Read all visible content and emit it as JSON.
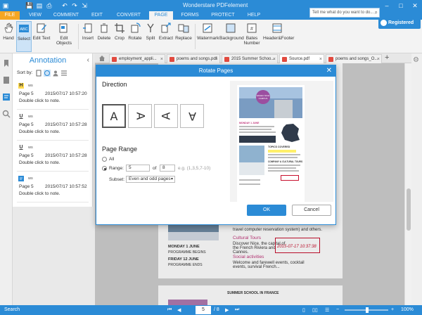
{
  "app": {
    "title": "Wonderstare PDFelement",
    "window_controls": [
      "minimize-icon",
      "maximize-icon",
      "close-icon"
    ],
    "quick_access": [
      "save-icon",
      "open-icon",
      "print-icon",
      "undo-icon",
      "redo-icon",
      "fit-icon"
    ]
  },
  "menu": {
    "tabs": [
      "FILE",
      "VIEW",
      "COMMENT",
      "EDIT",
      "CONVERT",
      "PAGE",
      "FORMS",
      "PROTECT",
      "HELP"
    ],
    "active": "PAGE"
  },
  "tell_me": {
    "placeholder": "Tell me what do you want to do..."
  },
  "account": {
    "label": "Registered"
  },
  "ribbon": {
    "tools": [
      {
        "label": "Hand",
        "icon": "hand-icon"
      },
      {
        "label": "Select",
        "icon": "select-icon"
      },
      {
        "label": "Edit Text",
        "icon": "edit-text-icon"
      },
      {
        "label": "Edit Objects",
        "icon": "edit-objects-icon"
      }
    ],
    "page_tools": [
      {
        "label": "Insert",
        "icon": "insert-icon"
      },
      {
        "label": "Delete",
        "icon": "delete-icon"
      },
      {
        "label": "Crop",
        "icon": "crop-icon"
      },
      {
        "label": "Rotate",
        "icon": "rotate-icon"
      },
      {
        "label": "Split",
        "icon": "split-icon"
      },
      {
        "label": "Extract",
        "icon": "extract-icon"
      },
      {
        "label": "Replace",
        "icon": "replace-icon"
      }
    ],
    "design_tools": [
      {
        "label": "Watermark",
        "icon": "watermark-icon"
      },
      {
        "label": "Background",
        "icon": "background-icon"
      },
      {
        "label": "Bates Number",
        "icon": "bates-number-icon"
      },
      {
        "label": "Header&Footer",
        "icon": "header-footer-icon"
      }
    ]
  },
  "annotation_panel": {
    "title": "Annotation",
    "sort_by": "Sort by:",
    "notes": [
      {
        "type": "H",
        "author": "ws",
        "page": "Page 5",
        "time": "2015/07/17 10:57:20",
        "text": "Double click to note."
      },
      {
        "type": "U",
        "author": "ws",
        "page": "Page 5",
        "time": "2015/07/17 10:57:28",
        "text": "Double click to note."
      },
      {
        "type": "U",
        "author": "ws",
        "page": "Page 5",
        "time": "2015/07/17 10:57:28",
        "text": "Double click to note."
      },
      {
        "type": "note",
        "author": "ws",
        "page": "Page 5",
        "time": "2015/07/17 10:57:52",
        "text": "Double click to note."
      }
    ]
  },
  "doc_tabs": [
    "employment_appli...",
    "poems and songs.pdf",
    "2015 Summer Schoo...",
    "Source.pdf",
    "poems and songs_O..."
  ],
  "document": {
    "travel_text": "travel computer reservation system) and others.",
    "cultural_tours": "Cultural Tours",
    "nice_text": "Discover Nice, the capital of the French Riviera and Cannes.",
    "social_activities": "Social activities",
    "welcome_text": "Welcome and farewell events, cocktail events, survival French...",
    "monday": "MONDAY 1 JUNE",
    "programme_begins": "PROGRAMME BEGINS",
    "friday": "FRIDAY 12 JUNE",
    "programme_ends": "PROGRAMME ENDS",
    "stamp": "2015-07-17 10:37:38",
    "next_page_title": "SUMMER SCHOOL IN FRANCE",
    "preview_header": "MONDAY 1 JUNE",
    "preview_topics": "TOPICS COVERED",
    "preview_company": "COMPANY & CULTURAL TOURS",
    "preview_logo": "EDHEC NICE CAMPUS"
  },
  "dialog": {
    "title": "Rotate Pages",
    "direction_label": "Direction",
    "direction_glyphs": [
      "A",
      "A",
      "A",
      "A"
    ],
    "page_range_label": "Page Range",
    "all_label": "All",
    "range_label": "Range:",
    "range_from": "5",
    "of_label": "of",
    "range_total": "8",
    "example": "e.g. (1,3,5,7-10)",
    "subset_label": "Subset:",
    "subset_value": "Even and odd pages",
    "ok_label": "OK",
    "cancel_label": "Cancel"
  },
  "status_bar": {
    "search_label": "Search",
    "current_page": "5",
    "total_pages": "/ 8",
    "zoom": "100%"
  },
  "colors": {
    "accent": "#2b8bd6",
    "file_tab": "#f5a623",
    "pink_heading": "#c0357a",
    "stamp_red": "#c8102e"
  }
}
